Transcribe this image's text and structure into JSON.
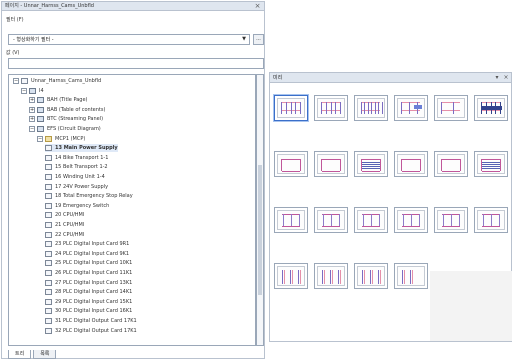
{
  "left_panel": {
    "title": "페이지 - Unnar_Harnss_Cams_Unbfld",
    "close_glyph": "×",
    "section_label": "필터 (F)",
    "combo_value": "- 형상화하기 필터 -",
    "combo_arrow": "▼",
    "combo_button": "...",
    "filter_label": "값 (V)",
    "tree": [
      {
        "indent": 0,
        "toggle": "−",
        "icon": "page",
        "text": "Unnar_Harnss_Cams_Unbfld",
        "bold": false
      },
      {
        "indent": 1,
        "toggle": "−",
        "icon": "book",
        "text": "I4",
        "bold": false
      },
      {
        "indent": 2,
        "toggle": "+",
        "icon": "book",
        "text": "BAH (Title Page)",
        "bold": false
      },
      {
        "indent": 2,
        "toggle": "+",
        "icon": "book",
        "text": "BAB (Table of contents)",
        "bold": false
      },
      {
        "indent": 2,
        "toggle": "+",
        "icon": "book",
        "text": "BTC (Streaming Panel)",
        "bold": false
      },
      {
        "indent": 2,
        "toggle": "−",
        "icon": "book",
        "text": "EFS (Circuit Diagram)",
        "bold": false
      },
      {
        "indent": 3,
        "toggle": "−",
        "icon": "folder",
        "text": "MCP1 (MCP)",
        "bold": false
      },
      {
        "indent": 4,
        "toggle": "",
        "icon": "page",
        "text": "13 Main Power Supply",
        "bold": true,
        "selected": true
      },
      {
        "indent": 4,
        "toggle": "",
        "icon": "page",
        "text": "14 Bike Transport 1-1",
        "bold": false
      },
      {
        "indent": 4,
        "toggle": "",
        "icon": "page",
        "text": "15 Belt Transport 1-2",
        "bold": false
      },
      {
        "indent": 4,
        "toggle": "",
        "icon": "page",
        "text": "16 Winding Unit 1-4",
        "bold": false
      },
      {
        "indent": 4,
        "toggle": "",
        "icon": "page",
        "text": "17 24V Power Supply",
        "bold": false
      },
      {
        "indent": 4,
        "toggle": "",
        "icon": "page",
        "text": "18 Total Emergency Stop Relay",
        "bold": false
      },
      {
        "indent": 4,
        "toggle": "",
        "icon": "page",
        "text": "19 Emergency Switch",
        "bold": false
      },
      {
        "indent": 4,
        "toggle": "",
        "icon": "page",
        "text": "20 CPU/HMI",
        "bold": false
      },
      {
        "indent": 4,
        "toggle": "",
        "icon": "page",
        "text": "21 CPU/HMI",
        "bold": false
      },
      {
        "indent": 4,
        "toggle": "",
        "icon": "page",
        "text": "22 CPU/HMI",
        "bold": false
      },
      {
        "indent": 4,
        "toggle": "",
        "icon": "page",
        "text": "23 PLC Digital Input Card 9R1",
        "bold": false
      },
      {
        "indent": 4,
        "toggle": "",
        "icon": "page",
        "text": "24 PLC Digital Input Card 9K1",
        "bold": false
      },
      {
        "indent": 4,
        "toggle": "",
        "icon": "page",
        "text": "25 PLC Digital Input Card 10K1",
        "bold": false
      },
      {
        "indent": 4,
        "toggle": "",
        "icon": "page",
        "text": "26 PLC Digital Input Card 11K1",
        "bold": false
      },
      {
        "indent": 4,
        "toggle": "",
        "icon": "page",
        "text": "27 PLC Digital Input Card 13K1",
        "bold": false
      },
      {
        "indent": 4,
        "toggle": "",
        "icon": "page",
        "text": "28 PLC Digital Input Card 14K1",
        "bold": false
      },
      {
        "indent": 4,
        "toggle": "",
        "icon": "page",
        "text": "29 PLC Digital Input Card 15K1",
        "bold": false
      },
      {
        "indent": 4,
        "toggle": "",
        "icon": "page",
        "text": "30 PLC Digital Input Card 16K1",
        "bold": false
      },
      {
        "indent": 4,
        "toggle": "",
        "icon": "page",
        "text": "31 PLC Digital Output Card 17K1",
        "bold": false
      },
      {
        "indent": 4,
        "toggle": "",
        "icon": "page",
        "text": "32 PLC Digital Output Card 17K1",
        "bold": false
      }
    ],
    "tabs": [
      {
        "label": "트리",
        "active": true
      },
      {
        "label": "목록",
        "active": false
      }
    ]
  },
  "right_panel": {
    "title": "미리",
    "pin_glyph": "▾",
    "close_glyph": "×",
    "thumbnails": [
      {
        "style": "bars",
        "selected": true
      },
      {
        "style": "bars",
        "selected": false
      },
      {
        "style": "dense",
        "selected": false
      },
      {
        "style": "mixed",
        "selected": false
      },
      {
        "style": "sparse",
        "selected": false
      },
      {
        "style": "navy",
        "selected": false
      },
      {
        "style": "lines",
        "selected": false
      },
      {
        "style": "lines",
        "selected": false
      },
      {
        "style": "dense-h",
        "selected": false
      },
      {
        "style": "lines",
        "selected": false
      },
      {
        "style": "lines",
        "selected": false
      },
      {
        "style": "dense-h",
        "selected": false
      },
      {
        "style": "boxes",
        "selected": false
      },
      {
        "style": "boxes",
        "selected": false
      },
      {
        "style": "boxes",
        "selected": false
      },
      {
        "style": "boxes",
        "selected": false
      },
      {
        "style": "boxes",
        "selected": false
      },
      {
        "style": "boxes",
        "selected": false
      },
      {
        "style": "columns",
        "selected": false
      },
      {
        "style": "columns",
        "selected": false
      },
      {
        "style": "columns",
        "selected": false
      },
      {
        "style": "columns-short",
        "selected": false
      }
    ]
  }
}
